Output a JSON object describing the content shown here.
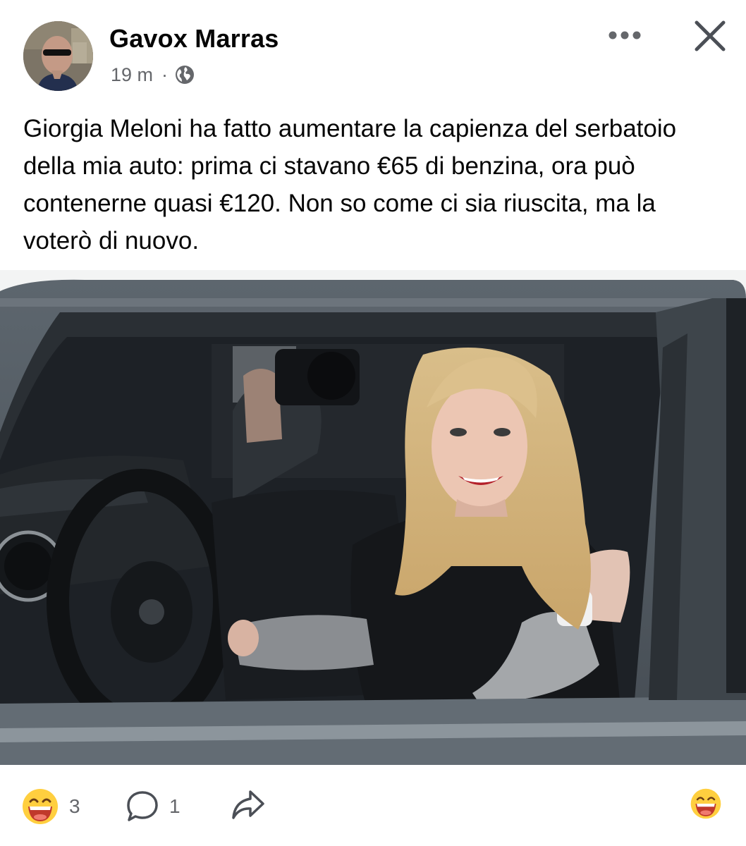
{
  "header": {
    "author_name": "Gavox Marras",
    "timestamp": "19 m",
    "separator": "·",
    "audience_icon": "globe-icon",
    "more_icon": "more-options-icon",
    "close_icon": "close-icon"
  },
  "post": {
    "text": "Giorgia Meloni ha fatto aumentare la capienza del serbatoio della mia auto: prima ci stavano €65 di benzina, ora può contenerne quasi €120. Non so come ci sia riuscita, ma la voterò di nuovo.",
    "image_kind": "photo"
  },
  "footer": {
    "reaction_icon": "laughing-emoji-icon",
    "reaction_count": "3",
    "comment_icon": "comment-icon",
    "comment_count": "1",
    "share_icon": "share-icon",
    "react_button_icon": "laughing-emoji-icon"
  },
  "colors": {
    "text": "#050505",
    "secondary_text": "#65676b",
    "emoji_face": "#ffcf3f",
    "emoji_mouth": "#c0392b"
  }
}
